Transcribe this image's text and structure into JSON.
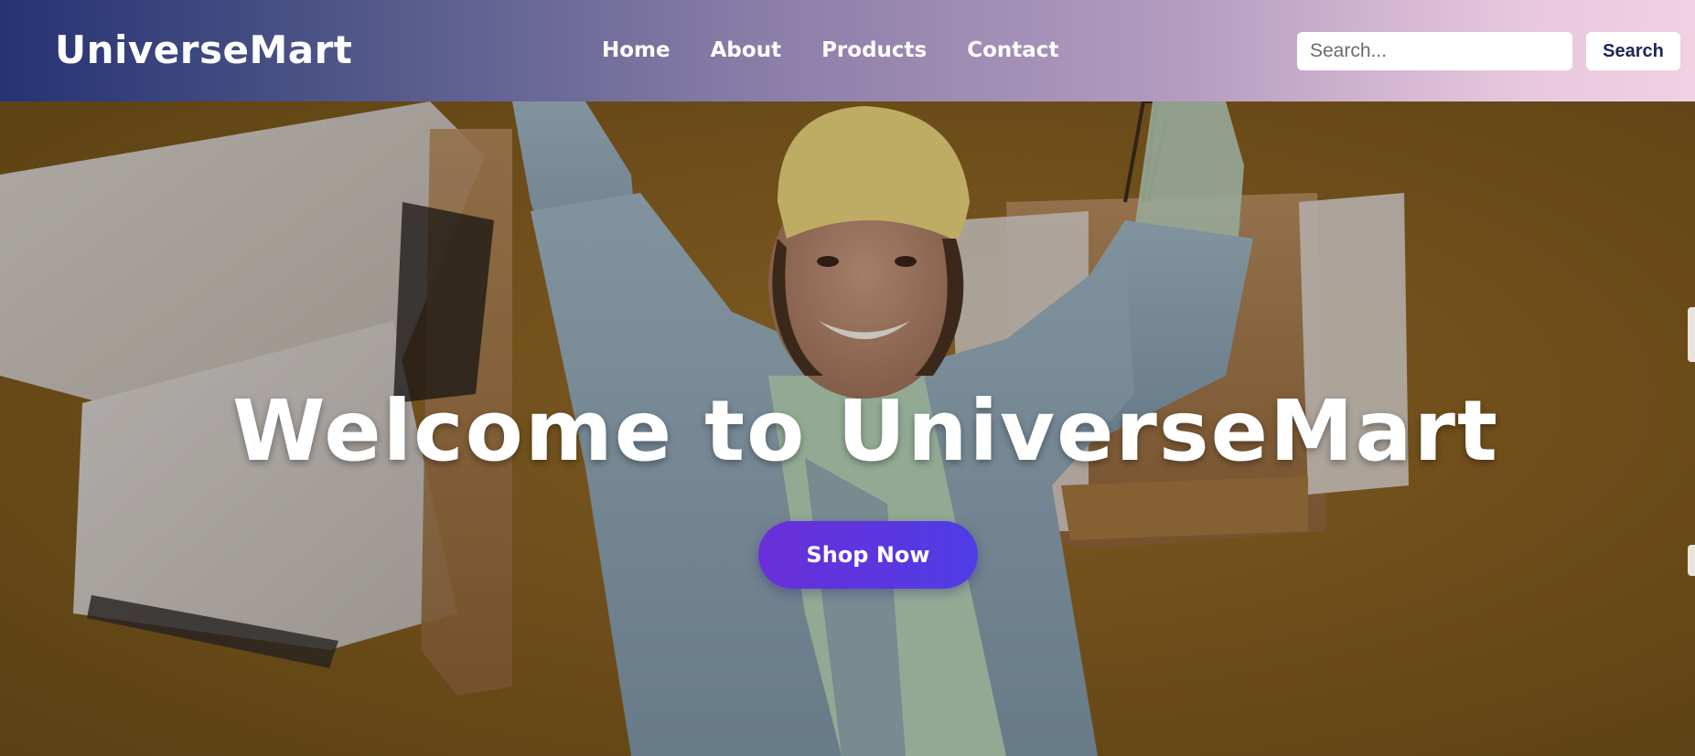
{
  "header": {
    "brand": "UniverseMart",
    "nav": [
      "Home",
      "About",
      "Products",
      "Contact"
    ],
    "search": {
      "placeholder": "Search...",
      "button_label": "Search"
    }
  },
  "hero": {
    "title": "Welcome to UniverseMart",
    "cta_label": "Shop Now",
    "background_image": "woman-with-shopping-bags"
  },
  "colors": {
    "header_gradient_start": "#263373",
    "header_gradient_end": "#f2d0e2",
    "hero_background": "#8a6222",
    "cta_gradient_start": "#6a2fd8",
    "cta_gradient_end": "#4f3de6",
    "search_button_text": "#1c2656"
  }
}
